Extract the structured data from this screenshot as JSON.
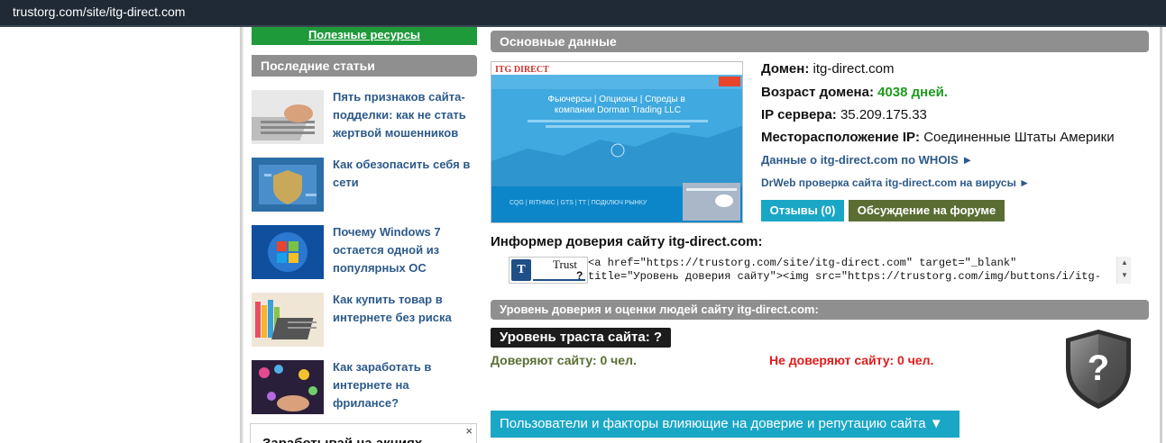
{
  "browser": {
    "url": "trustorg.com/site/itg-direct.com"
  },
  "sidebar": {
    "resources_button": "Полезные ресурсы",
    "recent_heading": "Последние статьи",
    "articles": [
      {
        "title": "Пять признаков сайта-подделки: как не стать жертвой мошенников"
      },
      {
        "title": "Как обезопасить себя в сети"
      },
      {
        "title": "Почему Windows 7 остается одной из популярных ОС"
      },
      {
        "title": "Как купить товар в интернете без риска"
      },
      {
        "title": "Как заработать в интернете на фрилансе?"
      }
    ],
    "ad": {
      "text": "Заработывай на акциях",
      "close": "×"
    }
  },
  "main": {
    "heading": "Основные данные",
    "screenshot": {
      "logo": "ITG DIRECT",
      "headline": "Фьючерсы | Опционы | Спреды в компании Dorman Trading LLC",
      "footer_links": "CQG | RITHMIC | GTS | TT | ПОДКЛЮЧ РЫНКУ"
    },
    "domain_label": "Домен:",
    "domain_value": "itg-direct.com",
    "age_label": "Возраст домена:",
    "age_value": "4038 дней.",
    "ip_label": "IP сервера:",
    "ip_value": "35.209.175.33",
    "location_label": "Месторасположение IP:",
    "location_value": "Соединенные Штаты Америки",
    "whois_link": "Данные о itg-direct.com по WHOIS ►",
    "drweb_link": "DrWeb проверка сайта itg-direct.com на вирусы ►",
    "reviews_button": "Отзывы (0)",
    "forum_button": "Обсуждение на форуме",
    "informer_title": "Информер доверия сайту itg-direct.com:",
    "badge": {
      "letter": "T",
      "text": "Trust",
      "mark": "?"
    },
    "code_line1": "<a href=\"https://trustorg.com/site/itg-direct.com\" target=\"_blank\"",
    "code_line2": "title=\"Уровень доверия сайту\"><img src=\"https://trustorg.com/img/buttons/i/itg-",
    "trust_heading": "Уровень доверия и оценки людей сайту itg-direct.com:",
    "trust_level": "Уровень траста сайта: ?",
    "trust_yes": "Доверяют сайту: 0 чел.",
    "trust_no": "Не доверяют сайту: 0 чел.",
    "shield_mark": "?",
    "users_button": "Пользователи и факторы влияющие на доверие и репутацию сайта ▼"
  },
  "colors": {
    "accent_green": "#1e9a3a",
    "teal": "#1aa7c6",
    "olive": "#5a6e33",
    "red": "#e01b1b",
    "link": "#2c5a8a",
    "bar_gray": "#8f8f8f"
  }
}
